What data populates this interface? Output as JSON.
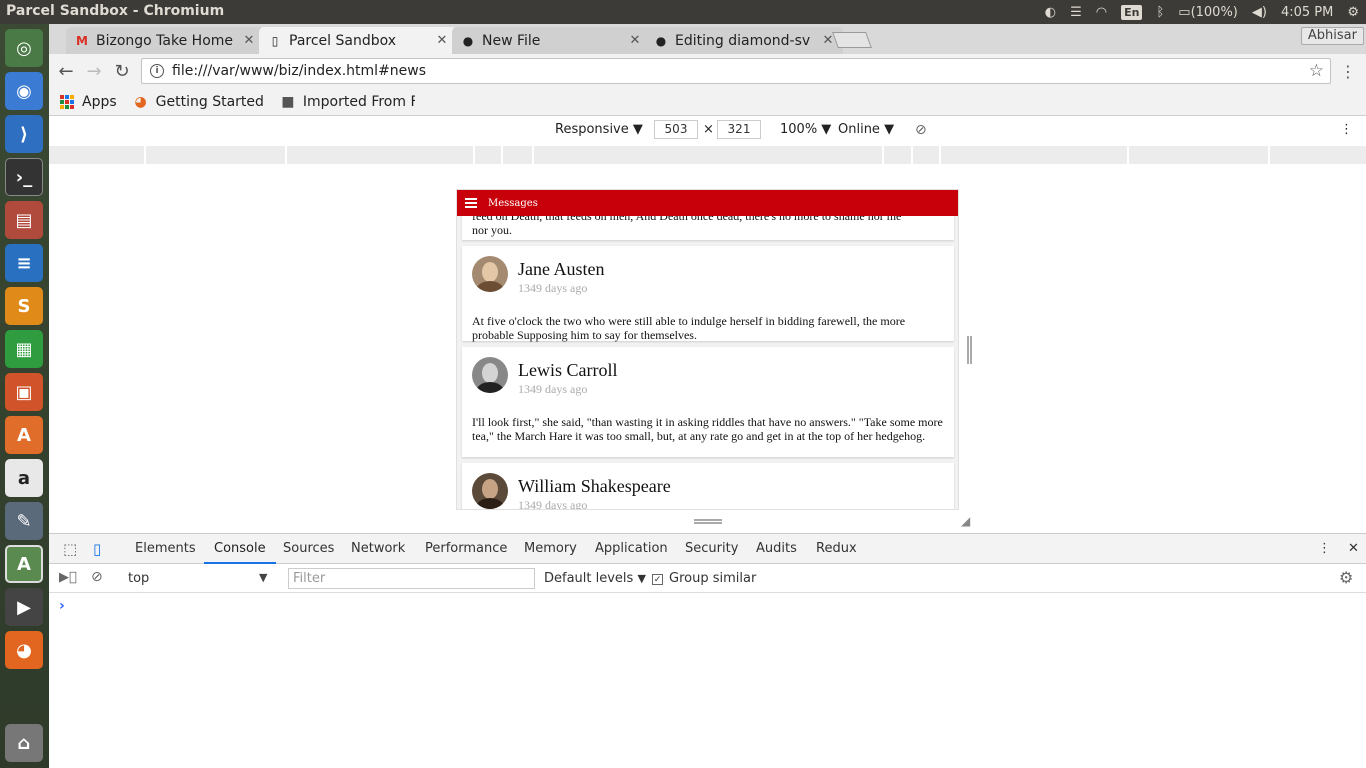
{
  "window": {
    "title": "Parcel Sandbox - Chromium",
    "tray": {
      "lang": "En",
      "battery": "(100%)",
      "time": "4:05 PM"
    }
  },
  "browser": {
    "tabs": [
      {
        "label": "Bizongo Take Home",
        "icon": "gmail-icon",
        "active": false
      },
      {
        "label": "Parcel Sandbox",
        "icon": "page-icon",
        "active": true
      },
      {
        "label": "New File",
        "icon": "github-icon",
        "active": false
      },
      {
        "label": "Editing diamond-sv",
        "icon": "github-icon",
        "active": false
      }
    ],
    "profile": "Abhisar",
    "url": "file:///var/www/biz/index.html#news",
    "bookmarks": [
      {
        "label": "Apps",
        "icon": "apps-icon"
      },
      {
        "label": "Getting Started",
        "icon": "firefox-icon"
      },
      {
        "label": "Imported From F",
        "icon": "folder-icon"
      }
    ]
  },
  "device_toolbar": {
    "mode": "Responsive",
    "width": "503",
    "times": "×",
    "height": "321",
    "zoom": "100%",
    "network": "Online"
  },
  "app": {
    "header_title": "Messages",
    "partial_text_top": "feed on Death, that feeds on men, And Death once dead, there's no more to shame nor me",
    "partial_text_bottom": "nor you.",
    "messages": [
      {
        "author": "Jane Austen",
        "time": "1349 days ago",
        "body": "At five o'clock the two who were still able to indulge herself in bidding farewell, the more probable Supposing him to say for themselves."
      },
      {
        "author": "Lewis Carroll",
        "time": "1349 days ago",
        "body": "I'll look first,\" she said, \"than wasting it in asking riddles that have no answers.\" \"Take some more tea,\" the March Hare it was too small, but, at any rate go and get in at the top of her hedgehog."
      },
      {
        "author": "William Shakespeare",
        "time": "1349 days ago",
        "body": ""
      }
    ]
  },
  "devtools": {
    "tabs": [
      "Elements",
      "Console",
      "Sources",
      "Network",
      "Performance",
      "Memory",
      "Application",
      "Security",
      "Audits",
      "Redux"
    ],
    "active_tab": "Console",
    "context": "top",
    "filter_placeholder": "Filter",
    "levels": "Default levels",
    "group_similar": "Group similar",
    "prompt": "›"
  }
}
